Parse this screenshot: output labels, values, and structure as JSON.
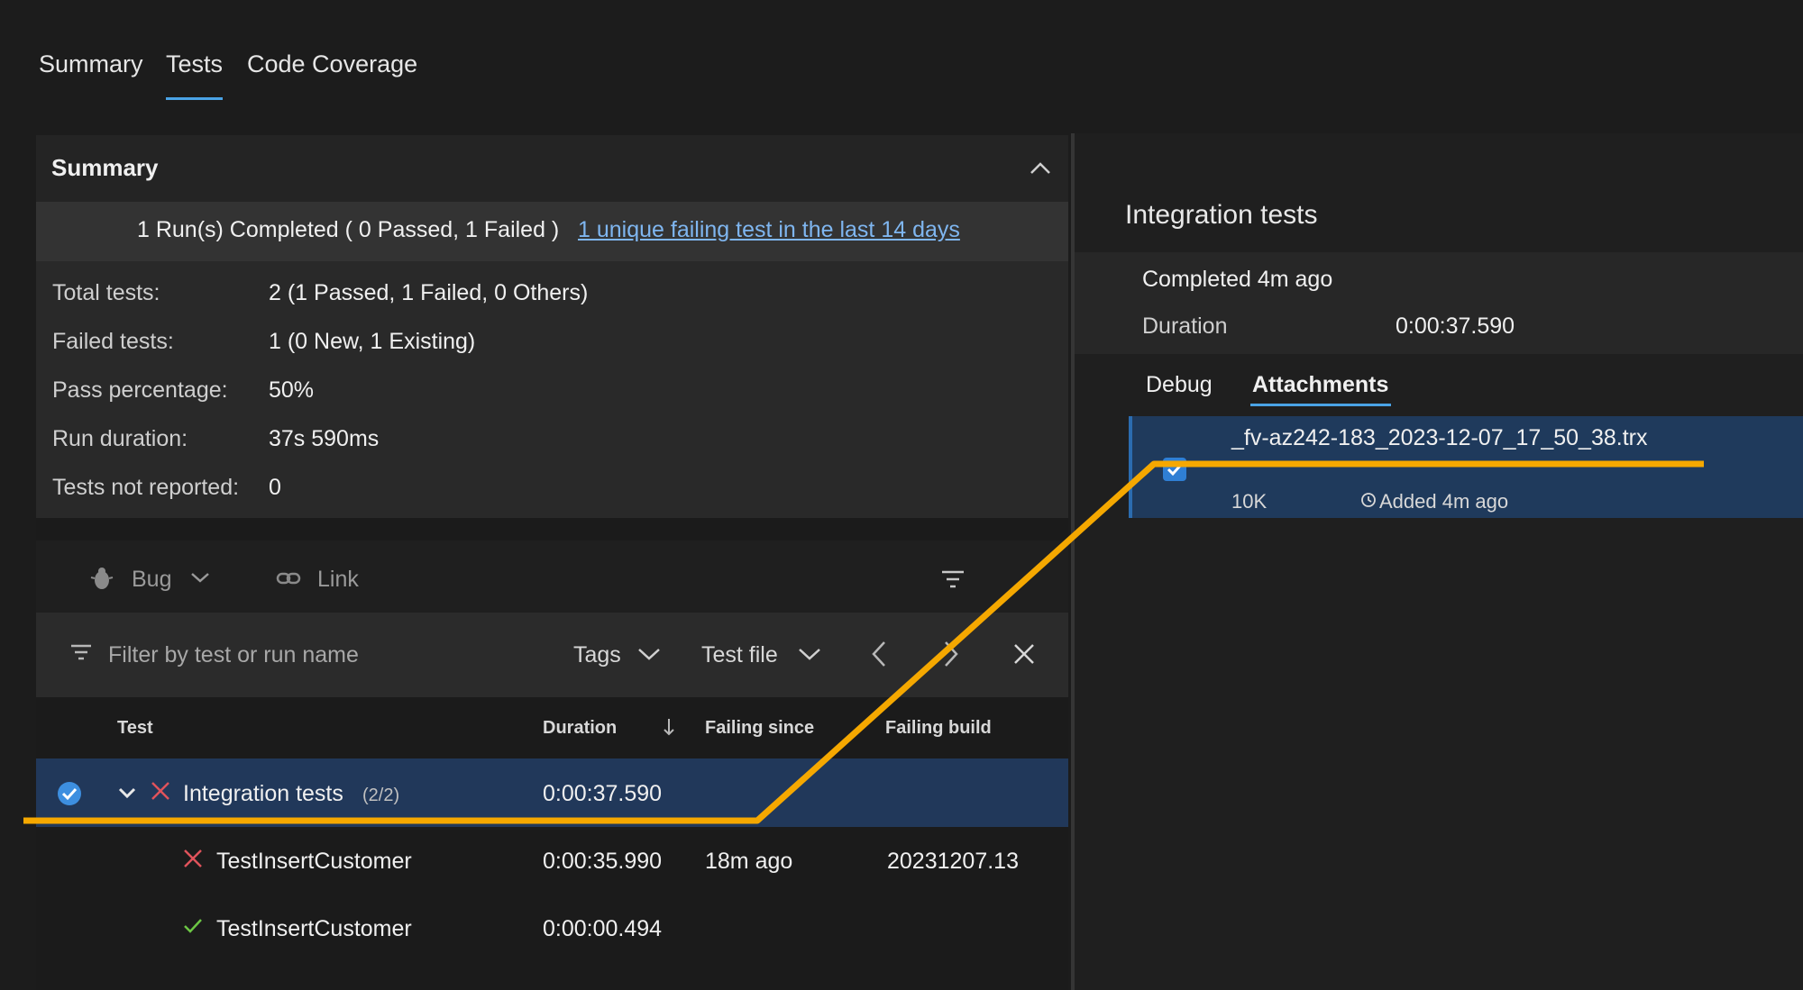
{
  "top_tabs": [
    {
      "label": "Summary"
    },
    {
      "label": "Tests"
    },
    {
      "label": "Code Coverage"
    }
  ],
  "summary": {
    "title": "Summary",
    "run_text": "1 Run(s) Completed ( 0 Passed, 1 Failed )",
    "run_link": "1 unique failing test in the last 14 days",
    "rows": [
      {
        "label": "Total tests:",
        "value": "2 (1 Passed, 1 Failed, 0 Others)"
      },
      {
        "label": "Failed tests:",
        "value": "1 (0 New, 1 Existing)"
      },
      {
        "label": "Pass percentage:",
        "value": "50%"
      },
      {
        "label": "Run duration:",
        "value": "37s 590ms"
      },
      {
        "label": "Tests not reported:",
        "value": "0"
      }
    ]
  },
  "toolbar": {
    "bug_label": "Bug",
    "link_label": "Link"
  },
  "filter": {
    "placeholder": "Filter by test or run name",
    "tags_label": "Tags",
    "testfile_label": "Test file"
  },
  "columns": {
    "test": "Test",
    "duration": "Duration",
    "failing_since": "Failing since",
    "failing_build": "Failing build"
  },
  "tests": [
    {
      "name": "Integration tests",
      "count": "(2/2)",
      "duration": "0:00:37.590",
      "failing_since": "",
      "failing_build": ""
    },
    {
      "name": "TestInsertCustomer",
      "duration": "0:00:35.990",
      "failing_since": "18m ago",
      "failing_build": "20231207.13"
    },
    {
      "name": "TestInsertCustomer",
      "duration": "0:00:00.494",
      "failing_since": "",
      "failing_build": ""
    }
  ],
  "details": {
    "title": "Integration tests",
    "completed": "Completed 4m ago",
    "duration_label": "Duration",
    "duration_value": "0:00:37.590",
    "tabs": [
      {
        "label": "Debug"
      },
      {
        "label": "Attachments"
      }
    ],
    "attachment": {
      "filename": "_fv-az242-183_2023-12-07_17_50_38.trx",
      "size": "10K",
      "added": "Added 4m ago"
    }
  },
  "colors": {
    "accent": "#4aa3e6",
    "highlight": "#f5a800",
    "fail": "#e0535b",
    "pass": "#6cc644",
    "selected": "#21385a"
  }
}
